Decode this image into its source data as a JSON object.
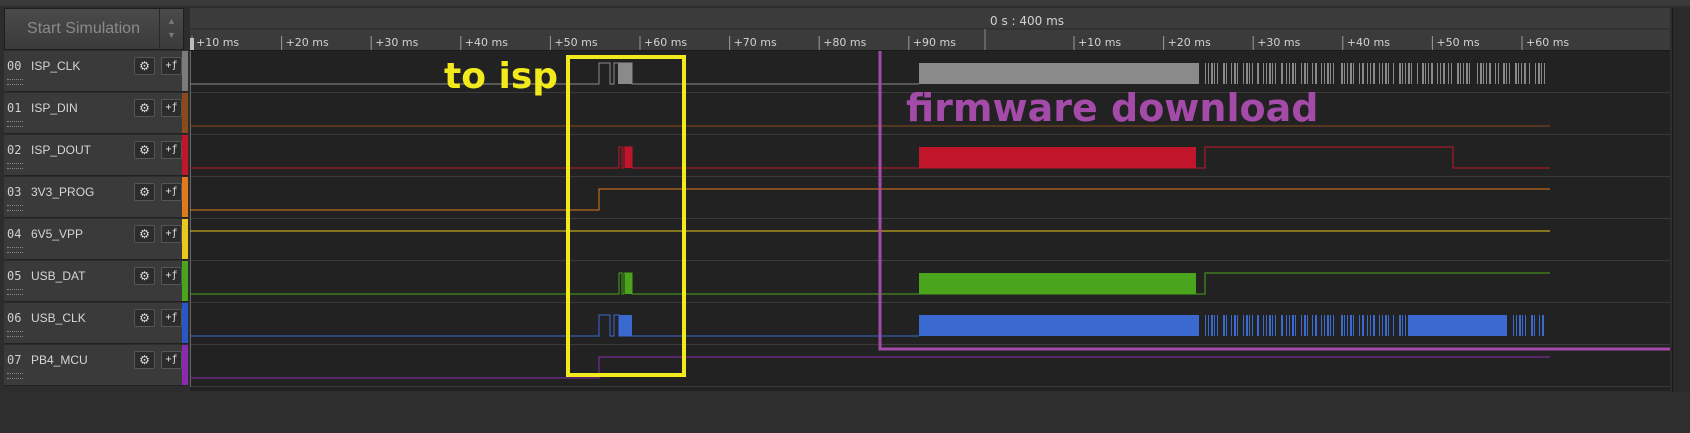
{
  "toolbar": {
    "start_label": "Start Simulation"
  },
  "ruler": {
    "top_label": "0 s : 400 ms",
    "ticks_before": [
      "+10 ms",
      "+20 ms",
      "+30 ms",
      "+40 ms",
      "+50 ms",
      "+60 ms",
      "+70 ms",
      "+80 ms",
      "+90 ms"
    ],
    "ticks_after": [
      "+10 ms",
      "+20 ms",
      "+30 ms",
      "+40 ms",
      "+50 ms",
      "+60 ms"
    ]
  },
  "channels": [
    {
      "num": "00",
      "name": "ISP_CLK",
      "color": "#7b7b7b"
    },
    {
      "num": "01",
      "name": "ISP_DIN",
      "color": "#8a4a1c"
    },
    {
      "num": "02",
      "name": "ISP_DOUT",
      "color": "#c0152a"
    },
    {
      "num": "03",
      "name": "3V3_PROG",
      "color": "#e07a1c"
    },
    {
      "num": "04",
      "name": "6V5_VPP",
      "color": "#e8c81c"
    },
    {
      "num": "05",
      "name": "USB_DAT",
      "color": "#4aa51c"
    },
    {
      "num": "06",
      "name": "USB_CLK",
      "color": "#2a56c8"
    },
    {
      "num": "07",
      "name": "PB4_MCU",
      "color": "#8a2ab0"
    }
  ],
  "annotations": {
    "isp_label": "to isp",
    "firmware_label": "firmware download",
    "isp_color": "#f2ea1a",
    "firmware_color": "#a44aa8"
  }
}
